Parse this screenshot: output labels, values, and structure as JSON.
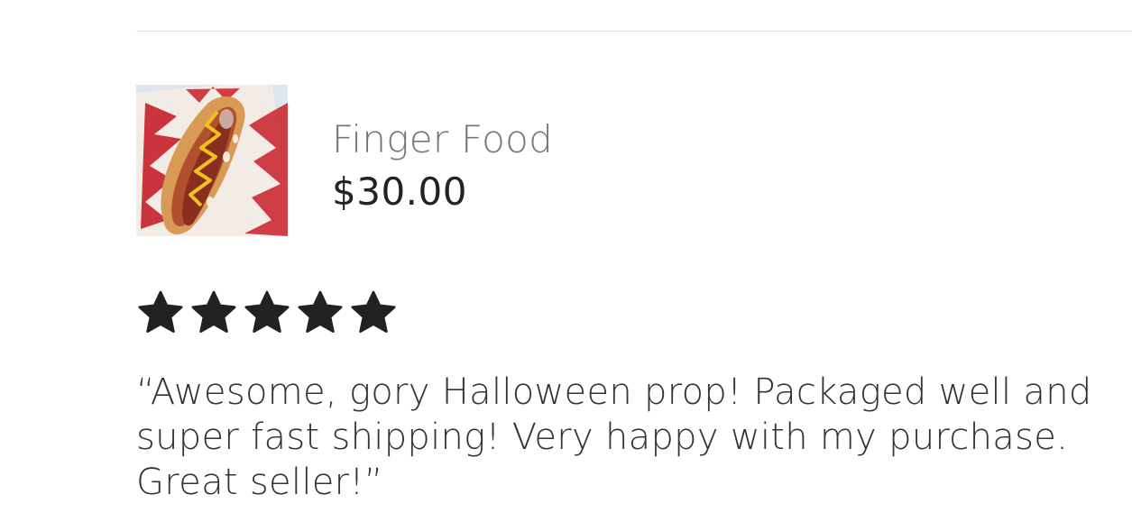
{
  "product": {
    "title": "Finger Food",
    "price": "$30.00",
    "thumbnail_icon": "hotdog-finger-image"
  },
  "review": {
    "rating": 5,
    "max_rating": 5,
    "star_color": "#222222",
    "text": "“Awesome, gory Halloween prop!  Packaged well and super fast shipping!  Very happy with my purchase.  Great seller!”"
  }
}
